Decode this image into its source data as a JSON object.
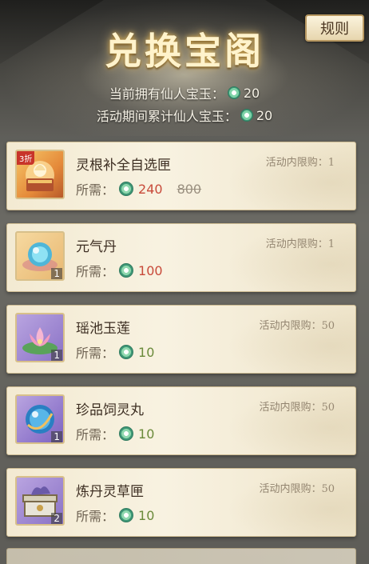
{
  "header": {
    "title": "兑换宝阁",
    "rules_label": "规则",
    "owned_label": "当前拥有仙人宝玉：",
    "owned_value": "20",
    "accumulated_label": "活动期间累计仙人宝玉：",
    "accumulated_value": "20"
  },
  "currency_icon": "jade-coin-icon",
  "cost_label": "所需：",
  "items": [
    {
      "name": "灵根补全自选匣",
      "limit": "活动内限购：1",
      "price": "240",
      "original_price": "800",
      "price_color": "#c84a3a",
      "count": "",
      "discount": "3折",
      "icon": "selection-box-icon"
    },
    {
      "name": "元气丹",
      "limit": "活动内限购：1",
      "price": "100",
      "original_price": "",
      "price_color": "#c84a3a",
      "count": "1",
      "discount": "",
      "icon": "pill-orb-icon"
    },
    {
      "name": "瑶池玉莲",
      "limit": "活动内限购：50",
      "price": "10",
      "original_price": "",
      "price_color": "#6a8a3a",
      "count": "1",
      "discount": "",
      "icon": "lotus-icon"
    },
    {
      "name": "珍品饲灵丸",
      "limit": "活动内限购：50",
      "price": "10",
      "original_price": "",
      "price_color": "#6a8a3a",
      "count": "1",
      "discount": "",
      "icon": "spirit-orb-icon"
    },
    {
      "name": "炼丹灵草匣",
      "limit": "活动内限购：50",
      "price": "10",
      "original_price": "",
      "price_color": "#6a8a3a",
      "count": "2",
      "discount": "",
      "icon": "herb-chest-icon"
    }
  ]
}
